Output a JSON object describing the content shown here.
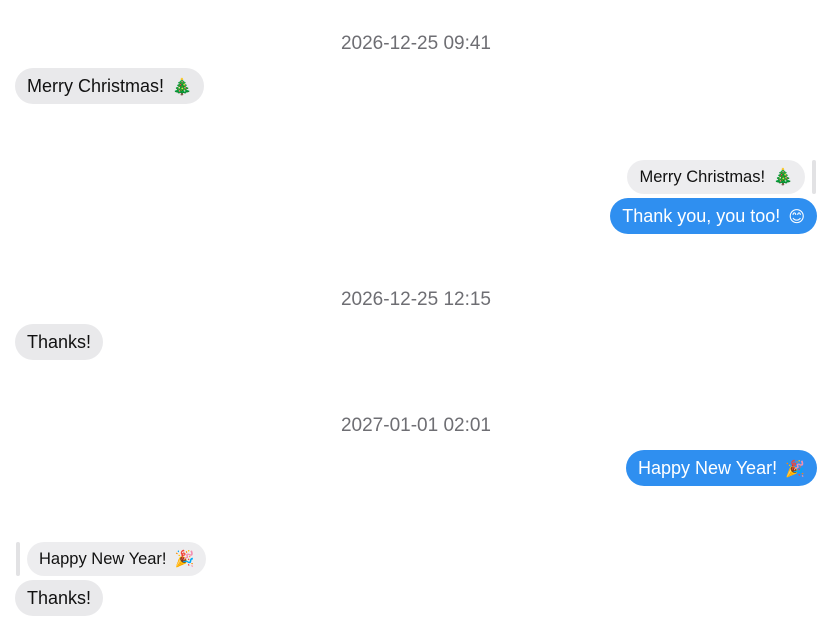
{
  "messages": [
    {
      "kind": "timestamp",
      "text": "2026-12-25 09:41"
    },
    {
      "kind": "incoming",
      "text": "Merry Christmas!",
      "emoji": "🎄"
    },
    {
      "kind": "reply-quote",
      "text": "Merry Christmas!",
      "emoji": "🎄"
    },
    {
      "kind": "outgoing",
      "text": "Thank you, you too!",
      "emoji": "😊"
    },
    {
      "kind": "timestamp",
      "text": "2026-12-25 12:15"
    },
    {
      "kind": "incoming",
      "text": "Thanks!"
    },
    {
      "kind": "timestamp",
      "text": "2027-01-01 02:01"
    },
    {
      "kind": "outgoing",
      "text": "Happy New Year!",
      "emoji": "🎉"
    },
    {
      "kind": "reply-quote",
      "text": "Happy New Year!",
      "emoji": "🎉"
    },
    {
      "kind": "incoming",
      "text": "Thanks!"
    }
  ],
  "colors": {
    "outgoing_bubble": "#2f8ff0",
    "incoming_bubble": "#e9e9eb",
    "timestamp_text": "#6e6e73"
  }
}
